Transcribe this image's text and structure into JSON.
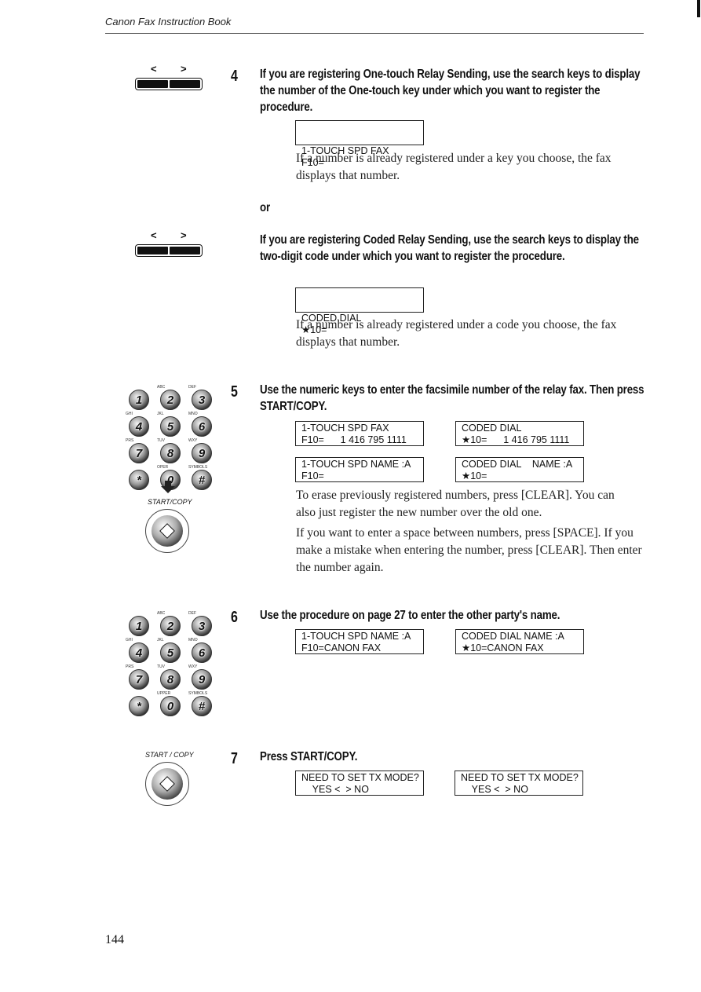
{
  "header": {
    "title": "Canon Fax Instruction Book"
  },
  "page_number": "144",
  "search_keys": {
    "left": "<",
    "right": ">"
  },
  "keypad": {
    "keys": [
      {
        "k": "1",
        "sub": ""
      },
      {
        "k": "2",
        "sub": "ABC"
      },
      {
        "k": "3",
        "sub": "DEF"
      },
      {
        "k": "4",
        "sub": "GHI"
      },
      {
        "k": "5",
        "sub": "JKL"
      },
      {
        "k": "6",
        "sub": "MNO"
      },
      {
        "k": "7",
        "sub": "PRS"
      },
      {
        "k": "8",
        "sub": "TUV"
      },
      {
        "k": "9",
        "sub": "WXY"
      },
      {
        "k": "*",
        "sub": ""
      },
      {
        "k": "0",
        "sub": "OPER"
      },
      {
        "k": "#",
        "sub": "SYMBOLS"
      }
    ],
    "keys_alt_sub": [
      "",
      "ABC",
      "DEF",
      "GHI",
      "JKL",
      "MNO",
      "PRS",
      "TUV",
      "WXY",
      "",
      "UPPER",
      "SYMBOLS"
    ]
  },
  "start_label_1": "START/COPY",
  "start_label_2": "START / COPY",
  "steps": {
    "s4": {
      "num": "4",
      "head": "If you are registering One-touch Relay Sending, use the search keys to display the number of the One-touch key under which you want to register the procedure.",
      "lcd": [
        "1-TOUCH SPD FAX",
        "F10="
      ],
      "body": "If a number is already registered under a key you choose, the fax displays that number."
    },
    "or": "or",
    "s4b": {
      "head": "If you are registering Coded Relay Sending, use the search keys to display the two-digit code under which you want to register the procedure.",
      "lcd": [
        "CODED DIAL",
        "★10="
      ],
      "body": "If a number is already registered under a code you choose, the fax displays that number."
    },
    "s5": {
      "num": "5",
      "head": "Use the numeric keys to enter the facsimile number of the relay fax. Then press START/COPY.",
      "lcd1": [
        "1-TOUCH SPD FAX",
        "F10=      1 416 795 1111"
      ],
      "lcd2": [
        "CODED DIAL",
        "★10=      1 416 795 1111"
      ],
      "lcd3": [
        "1-TOUCH SPD NAME :A",
        "F10="
      ],
      "lcd4": [
        "CODED DIAL    NAME :A",
        "★10="
      ],
      "body1": "To erase previously registered numbers, press [CLEAR]. You can also just register the new number over the old one.",
      "body2": "If you want to enter a space between numbers, press [SPACE]. If you make a mistake when entering the number, press [CLEAR]. Then enter the number again."
    },
    "s6": {
      "num": "6",
      "head": "Use the procedure on page 27 to enter the other party's name.",
      "lcd1": [
        "1-TOUCH SPD NAME :A",
        "F10=CANON FAX"
      ],
      "lcd2": [
        "CODED DIAL NAME :A",
        "★10=CANON FAX"
      ]
    },
    "s7": {
      "num": "7",
      "head": "Press START/COPY.",
      "lcd1": [
        "NEED TO SET TX MODE?",
        "    YES <  > NO"
      ],
      "lcd2": [
        "NEED TO SET TX MODE?",
        "    YES <  > NO"
      ]
    }
  }
}
